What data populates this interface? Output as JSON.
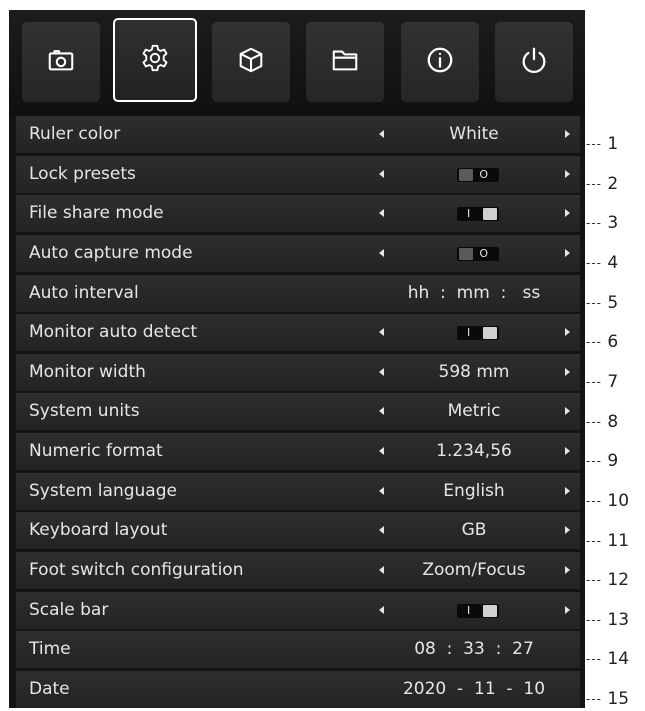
{
  "tabs": [
    {
      "icon": "camera-icon",
      "active": false
    },
    {
      "icon": "gear-icon",
      "active": true
    },
    {
      "icon": "cube-icon",
      "active": false
    },
    {
      "icon": "folder-icon",
      "active": false
    },
    {
      "icon": "info-icon",
      "active": false
    },
    {
      "icon": "power-icon",
      "active": false
    }
  ],
  "settings": [
    {
      "label": "Ruler color",
      "type": "select",
      "value": "White",
      "callout": "1"
    },
    {
      "label": "Lock presets",
      "type": "toggle",
      "state": "off",
      "mark": "O",
      "callout": "2"
    },
    {
      "label": "File share mode",
      "type": "toggle",
      "state": "on",
      "mark": "I",
      "callout": "3"
    },
    {
      "label": "Auto capture mode",
      "type": "toggle",
      "state": "off",
      "mark": "O",
      "callout": "4"
    },
    {
      "label": "Auto interval",
      "type": "time",
      "value": "hh  :  mm  :   ss",
      "callout": "5"
    },
    {
      "label": "Monitor auto detect",
      "type": "toggle",
      "state": "on",
      "mark": "I",
      "callout": "6"
    },
    {
      "label": "Monitor width",
      "type": "select",
      "value": "598 mm",
      "callout": "7"
    },
    {
      "label": "System units",
      "type": "select",
      "value": "Metric",
      "callout": "8"
    },
    {
      "label": "Numeric format",
      "type": "select",
      "value": "1.234,56",
      "callout": "9"
    },
    {
      "label": "System language",
      "type": "select",
      "value": "English",
      "callout": "10"
    },
    {
      "label": "Keyboard layout",
      "type": "select",
      "value": "GB",
      "callout": "11"
    },
    {
      "label": "Foot switch configuration",
      "type": "select",
      "value": "Zoom/Focus",
      "callout": "12"
    },
    {
      "label": "Scale bar",
      "type": "toggle",
      "state": "on",
      "mark": "I",
      "callout": "13"
    },
    {
      "label": "Time",
      "type": "time",
      "value": "08  :  33  :  27",
      "callout": "14"
    },
    {
      "label": "Date",
      "type": "time",
      "value": "2020  -  11  -  10",
      "callout": "15"
    }
  ],
  "callout_dash": "---",
  "colors": {
    "panel": "#141414",
    "row": "#2a2a2a",
    "text": "#e6e6e6",
    "active_border": "#ffffff"
  }
}
